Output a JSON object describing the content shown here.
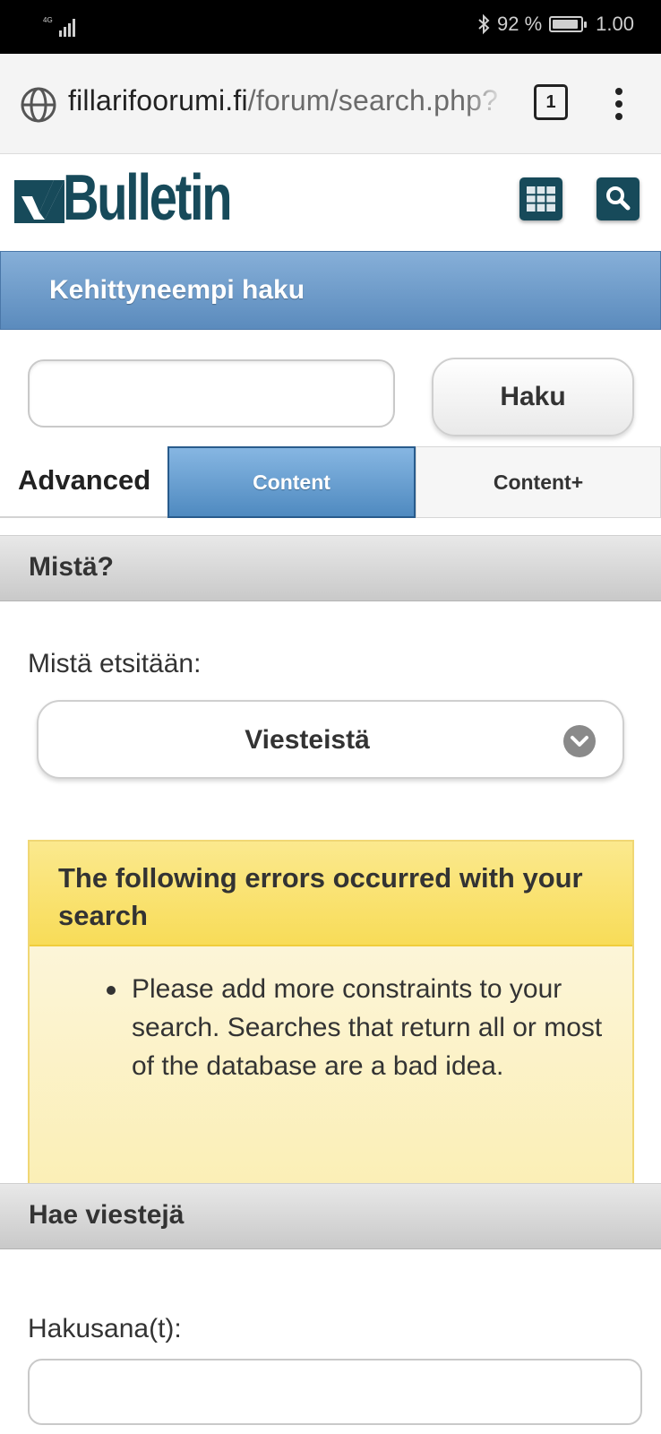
{
  "status_bar": {
    "network": "4G",
    "battery": "92 %",
    "battery_level": 0.92,
    "time": "1.00",
    "icons": [
      "signal-icon",
      "bluetooth-icon",
      "battery-icon"
    ]
  },
  "browser": {
    "url_host": "fillarifoorumi.fi",
    "url_path": "/forum/search.php?",
    "tab_count": "1"
  },
  "header": {
    "logo_text": "vBulletin",
    "brand_color": "#174a5a"
  },
  "title_bar": {
    "title": "Kehittyneempi haku",
    "color": "#5b8bbd"
  },
  "search": {
    "value": "",
    "button_label": "Haku"
  },
  "tabs": {
    "advanced": "Advanced",
    "content": "Content",
    "content_plus": "Content+",
    "active": "Content"
  },
  "section_where": {
    "title": "Mistä?",
    "label": "Mistä etsitään:",
    "selected": "Viesteistä"
  },
  "errors": {
    "heading": "The following errors occurred with your search",
    "items": [
      "Please add more constraints to your search. Searches that return all or most of the database are a bad idea."
    ]
  },
  "section_posts": {
    "title": "Hae viestejä",
    "label": "Hakusana(t):",
    "value": ""
  }
}
